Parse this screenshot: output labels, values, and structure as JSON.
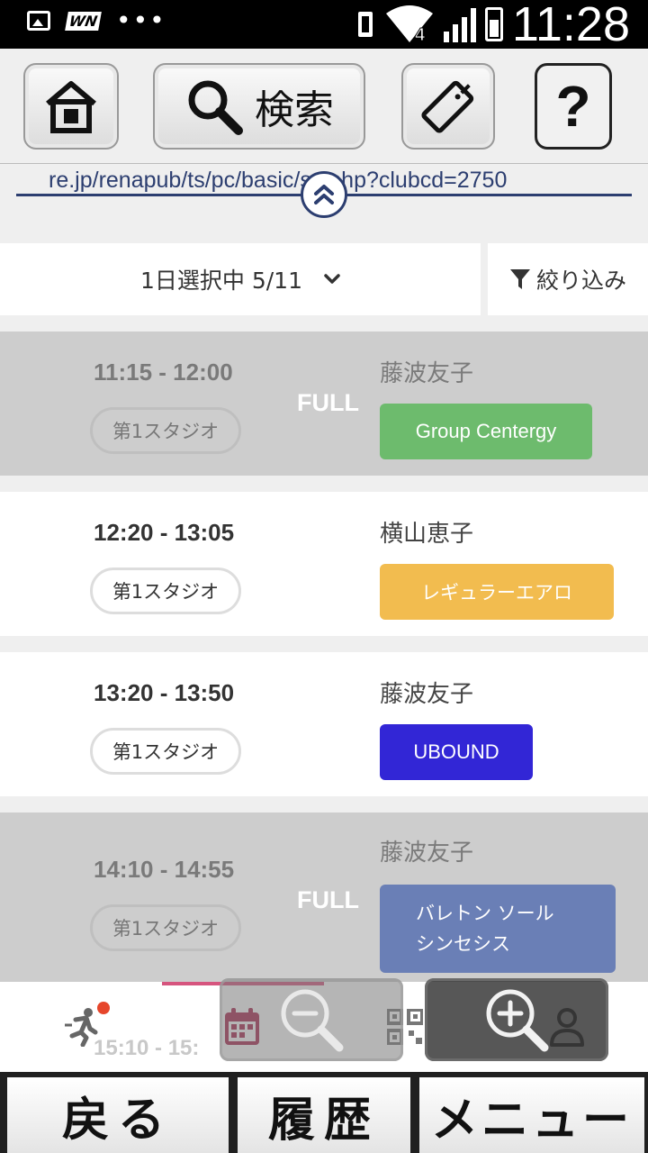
{
  "status_bar": {
    "time": "11:28",
    "left_icons": [
      "image-icon",
      "wn-icon",
      "more-dots-icon"
    ],
    "wn_label": "WN",
    "more_dots": "•••",
    "network_badge": "4"
  },
  "toolbar": {
    "home_icon": "home-icon",
    "search_label": "検索",
    "tag_icon": "tag-icon",
    "help_label": "?"
  },
  "url": {
    "text": "re.jp/renapub/ts/pc/basic/sc.php?clubcd=2750"
  },
  "filter": {
    "day_label": "1日選択中 5/11",
    "filter_label": "絞り込み"
  },
  "lessons": [
    {
      "time": "11:15 - 12:00",
      "studio": "第1スタジオ",
      "status": "FULL",
      "instructor": "藤波友子",
      "program": "Group Centergy",
      "color": "#6dbb6d"
    },
    {
      "time": "12:20 - 13:05",
      "studio": "第1スタジオ",
      "status": "",
      "instructor": "横山恵子",
      "program": "レギュラーエアロ",
      "color": "#f2bc4f"
    },
    {
      "time": "13:20 - 13:50",
      "studio": "第1スタジオ",
      "status": "",
      "instructor": "藤波友子",
      "program": "UBOUND",
      "color": "#3226d6"
    },
    {
      "time": "14:10 - 14:55",
      "studio": "第1スタジオ",
      "status": "FULL",
      "instructor": "藤波友子",
      "program": "バレトン ソール\nシンセシス",
      "color": "#6a7fb6"
    }
  ],
  "partially_hidden_time": "15:10 - 15:",
  "colors": {
    "accent_navy": "#2c3e70",
    "tab_indicator": "#d6557e",
    "calendar_active": "#a8264e",
    "notification": "#e6462b"
  },
  "tab_bar": {
    "icons": [
      "runner-icon",
      "calendar-icon",
      "qr-code-icon",
      "user-icon"
    ],
    "active_index": 1
  },
  "zoom": {
    "out_icon": "zoom-out-icon",
    "in_icon": "zoom-in-icon"
  },
  "bottom_nav": {
    "back_label": "戻る",
    "history_label": "履歴",
    "menu_label": "メニュー"
  }
}
